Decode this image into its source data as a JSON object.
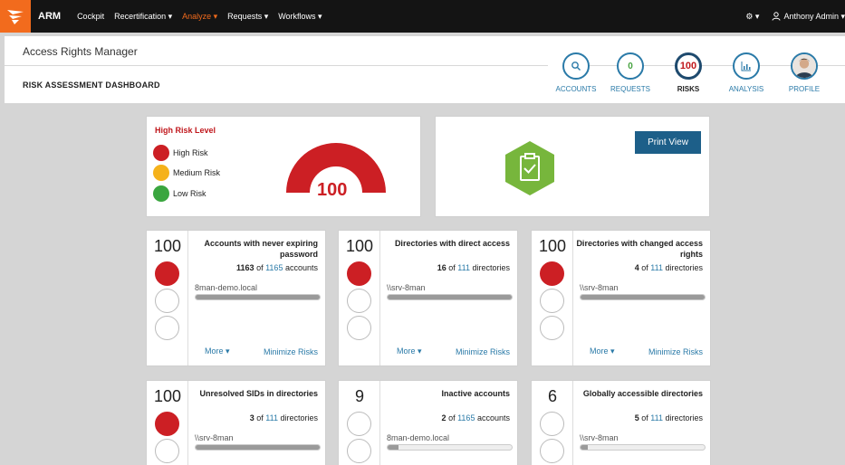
{
  "topnav": {
    "brand": "ARM",
    "items": [
      {
        "label": "Cockpit",
        "active": false
      },
      {
        "label": "Recertification ▾",
        "active": false
      },
      {
        "label": "Analyze ▾",
        "active": true
      },
      {
        "label": "Requests ▾",
        "active": false
      },
      {
        "label": "Workflows ▾",
        "active": false
      }
    ],
    "settings_label": "▾",
    "user_label": "Anthony Admin ▾",
    "colors": {
      "background": "#141414",
      "accent": "#f26b1d"
    }
  },
  "header": {
    "app_title": "Access Rights Manager",
    "page_title": "RISK ASSESSMENT DASHBOARD",
    "nav": [
      {
        "label": "ACCOUNTS",
        "icon": "search-icon",
        "value": ""
      },
      {
        "label": "REQUESTS",
        "icon": "",
        "value": "0"
      },
      {
        "label": "RISKS",
        "icon": "",
        "value": "100"
      },
      {
        "label": "ANALYSIS",
        "icon": "bar-chart-icon",
        "value": ""
      },
      {
        "label": "PROFILE",
        "icon": "avatar-icon",
        "value": ""
      }
    ]
  },
  "risk_level": {
    "title": "High Risk Level",
    "legend": [
      {
        "label": "High Risk",
        "color": "#cc1f24"
      },
      {
        "label": "Medium Risk",
        "color": "#f5b21b"
      },
      {
        "label": "Low Risk",
        "color": "#3aa63f"
      }
    ],
    "gauge_value": "100",
    "gauge_fraction": 1.0,
    "gauge_color": "#cc1f24"
  },
  "status_card": {
    "icon": "clipboard-check-icon",
    "icon_color": "#77b63c",
    "print_label": "Print View"
  },
  "metrics": [
    {
      "score": "100",
      "level": "high",
      "title": "Accounts with never expiring password",
      "count_value": "1163",
      "count_of": "of",
      "count_total": "1165",
      "count_unit": "accounts",
      "source": "8man-demo.local",
      "fraction": 0.998,
      "more": "More ▾",
      "minimize": "Minimize Risks"
    },
    {
      "score": "100",
      "level": "high",
      "title": "Directories with direct access",
      "count_value": "16",
      "count_of": "of",
      "count_total": "111",
      "count_unit": "directories",
      "source": "\\\\srv-8man",
      "fraction": 1.0,
      "more": "More ▾",
      "minimize": "Minimize Risks"
    },
    {
      "score": "100",
      "level": "high",
      "title": "Directories with changed access rights",
      "count_value": "4",
      "count_of": "of",
      "count_total": "111",
      "count_unit": "directories",
      "source": "\\\\srv-8man",
      "fraction": 1.0,
      "more": "More ▾",
      "minimize": "Minimize Risks"
    },
    {
      "score": "100",
      "level": "high",
      "title": "Unresolved SIDs in directories",
      "count_value": "3",
      "count_of": "of",
      "count_total": "111",
      "count_unit": "directories",
      "source": "\\\\srv-8man",
      "fraction": 1.0,
      "more": "",
      "minimize": ""
    },
    {
      "score": "9",
      "level": "low",
      "title": "Inactive accounts",
      "count_value": "2",
      "count_of": "of",
      "count_total": "1165",
      "count_unit": "accounts",
      "source": "8man-demo.local",
      "fraction": 0.09,
      "more": "",
      "minimize": ""
    },
    {
      "score": "6",
      "level": "low",
      "title": "Globally accessible directories",
      "count_value": "5",
      "count_of": "of",
      "count_total": "111",
      "count_unit": "directories",
      "source": "\\\\srv-8man",
      "fraction": 0.06,
      "more": "",
      "minimize": ""
    }
  ]
}
